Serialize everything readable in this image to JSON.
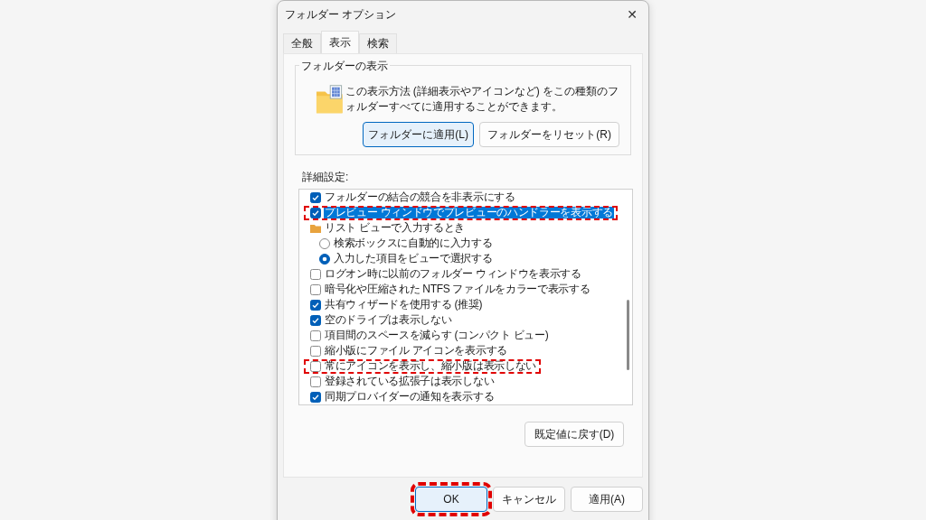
{
  "window": {
    "title": "フォルダー オプション",
    "close": "✕"
  },
  "tabs": [
    {
      "label": "全般",
      "selected": false
    },
    {
      "label": "表示",
      "selected": true
    },
    {
      "label": "検索",
      "selected": false
    }
  ],
  "folder_views": {
    "title": "フォルダーの表示",
    "description": "この表示方法 (詳細表示やアイコンなど) をこの種類のフォルダーすべてに適用することができます。",
    "buttons": [
      {
        "label": "フォルダーに適用(L)",
        "focused": true
      },
      {
        "label": "フォルダーをリセット(R)",
        "focused": false
      }
    ]
  },
  "advanced": {
    "title": "詳細設定:",
    "rows": [
      {
        "kind": "checkbox",
        "label": "フォルダーの結合の競合を非表示にする",
        "checked": true,
        "selected": false,
        "highlighted": false
      },
      {
        "kind": "checkbox",
        "label": "プレビュー ウィンドウでプレビューのハンドラーを表示する",
        "checked": true,
        "selected": true,
        "highlighted": true
      },
      {
        "kind": "group",
        "label": "リスト ビューで入力するとき",
        "selected": false,
        "highlighted": false,
        "children": [
          {
            "kind": "radio",
            "label": "検索ボックスに自動的に入力する",
            "checked": false
          },
          {
            "kind": "radio",
            "label": "入力した項目をビューで選択する",
            "checked": true
          }
        ]
      },
      {
        "kind": "checkbox",
        "label": "ログオン時に以前のフォルダー ウィンドウを表示する",
        "checked": false,
        "selected": false,
        "highlighted": false
      },
      {
        "kind": "checkbox",
        "label": "暗号化や圧縮された NTFS ファイルをカラーで表示する",
        "checked": false,
        "selected": false,
        "highlighted": false
      },
      {
        "kind": "checkbox",
        "label": "共有ウィザードを使用する (推奨)",
        "checked": true,
        "selected": false,
        "highlighted": false
      },
      {
        "kind": "checkbox",
        "label": "空のドライブは表示しない",
        "checked": true,
        "selected": false,
        "highlighted": false
      },
      {
        "kind": "checkbox",
        "label": "項目間のスペースを減らす (コンパクト ビュー)",
        "checked": false,
        "selected": false,
        "highlighted": false
      },
      {
        "kind": "checkbox",
        "label": "縮小版にファイル アイコンを表示する",
        "checked": false,
        "selected": false,
        "highlighted": false
      },
      {
        "kind": "checkbox",
        "label": "常にアイコンを表示し、縮小版は表示しない",
        "checked": false,
        "selected": false,
        "highlighted": true
      },
      {
        "kind": "checkbox",
        "label": "登録されている拡張子は表示しない",
        "checked": false,
        "selected": false,
        "highlighted": false
      },
      {
        "kind": "checkbox",
        "label": "同期プロバイダーの通知を表示する",
        "checked": true,
        "selected": false,
        "highlighted": false
      }
    ],
    "restore_button": "既定値に戻す(D)"
  },
  "buttons": [
    {
      "label": "OK",
      "default": true,
      "highlighted": true
    },
    {
      "label": "キャンセル",
      "default": false,
      "highlighted": false
    },
    {
      "label": "適用(A)",
      "default": false,
      "highlighted": false
    }
  ]
}
